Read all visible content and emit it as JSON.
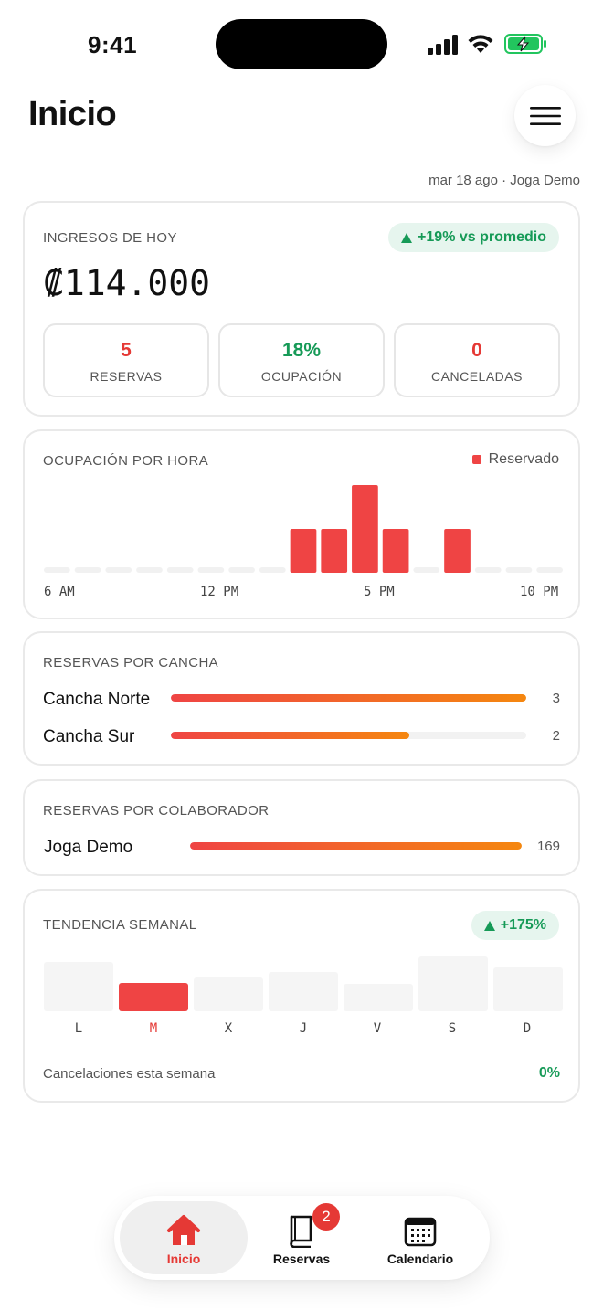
{
  "status_bar": {
    "time": "9:41"
  },
  "header": {
    "title": "Inicio",
    "subline": "mar 18 ago · Joga Demo"
  },
  "ingresos": {
    "label": "INGRESOS DE HOY",
    "pill": "+19% vs promedio",
    "amount": "₡114.000",
    "stats": [
      {
        "value": "5",
        "label": "RESERVAS",
        "color": "#e53935"
      },
      {
        "value": "18%",
        "label": "OCUPACIÓN",
        "color": "#169a57"
      },
      {
        "value": "0",
        "label": "CANCELADAS",
        "color": "#e53935"
      }
    ]
  },
  "ocupacion": {
    "label": "OCUPACIÓN POR HORA",
    "legend": "Reservado",
    "axis_labels": [
      "6 AM",
      "12 PM",
      "5 PM",
      "10 PM"
    ],
    "hours": [
      0,
      0,
      0,
      0,
      0,
      0,
      0,
      0,
      1,
      1,
      2,
      1,
      0,
      1,
      0,
      0,
      0
    ]
  },
  "canchas": {
    "label": "RESERVAS POR CANCHA",
    "rows": [
      {
        "name": "Cancha Norte",
        "count": "3",
        "ratio": 1.0
      },
      {
        "name": "Cancha Sur",
        "count": "2",
        "ratio": 0.67
      }
    ]
  },
  "colaboradores": {
    "label": "RESERVAS POR COLABORADOR",
    "rows": [
      {
        "name": "Joga Demo",
        "count": "169",
        "ratio": 1.0
      }
    ]
  },
  "tendencia": {
    "label": "TENDENCIA SEMANAL",
    "pill": "+175%",
    "days": [
      {
        "label": "L",
        "value": 0.54,
        "active": false
      },
      {
        "label": "M",
        "value": 0.31,
        "active": true
      },
      {
        "label": "X",
        "value": 0.37,
        "active": false
      },
      {
        "label": "J",
        "value": 0.43,
        "active": false
      },
      {
        "label": "V",
        "value": 0.3,
        "active": false
      },
      {
        "label": "S",
        "value": 0.6,
        "active": false
      },
      {
        "label": "D",
        "value": 0.48,
        "active": false
      }
    ],
    "cancel_label": "Cancelaciones esta semana",
    "cancel_value": "0%"
  },
  "nav": {
    "items": [
      {
        "label": "Inicio",
        "icon": "home-icon",
        "active": true
      },
      {
        "label": "Reservas",
        "icon": "book-icon",
        "active": false
      },
      {
        "label": "Calendario",
        "icon": "calendar-icon",
        "active": false
      }
    ],
    "badge": "2"
  },
  "colors": {
    "accent_red": "#ef4444",
    "accent_orange": "#f5870f",
    "positive_green": "#169a57"
  }
}
